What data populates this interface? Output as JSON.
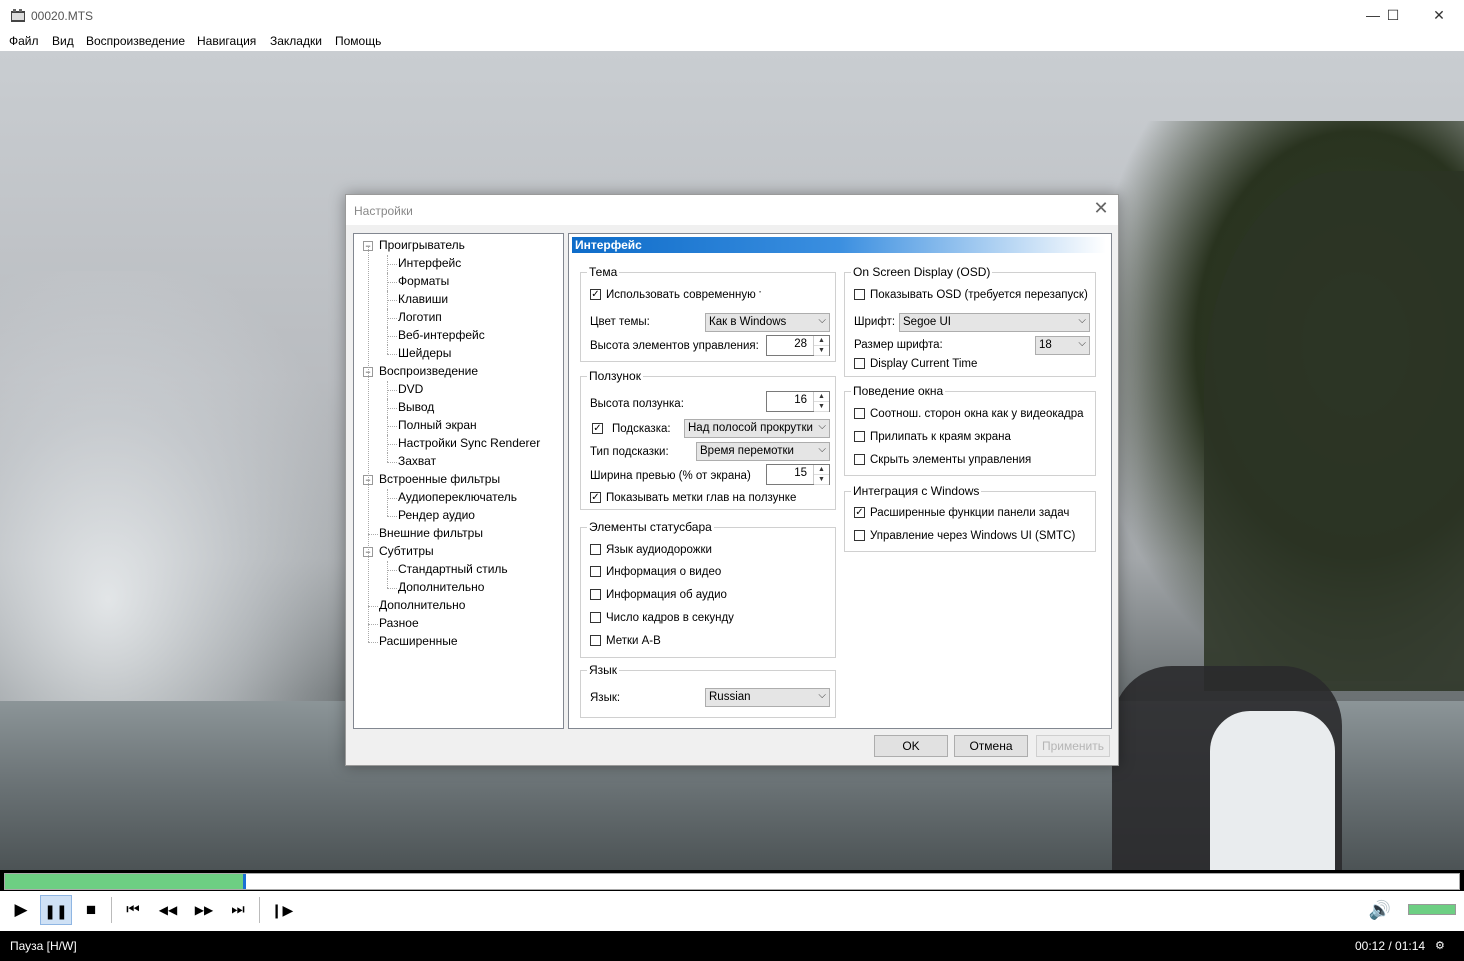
{
  "window": {
    "title": "00020.MTS",
    "minimize": "—",
    "maximize": "☐",
    "close": "✕"
  },
  "menu": [
    "Файл",
    "Вид",
    "Воспроизведение",
    "Навигация",
    "Закладки",
    "Помощь"
  ],
  "playback": {
    "progress_fraction": 0.164,
    "volume_fraction": 1.0
  },
  "status": {
    "state": "Пауза [H/W]",
    "time": "00:12 / 01:14"
  },
  "dialog": {
    "title": "Настройки",
    "close": "✕",
    "tree": [
      {
        "label": "Проигрыватель",
        "level": 0,
        "toggle": "−"
      },
      {
        "label": "Интерфейс",
        "level": 1
      },
      {
        "label": "Форматы",
        "level": 1
      },
      {
        "label": "Клавиши",
        "level": 1
      },
      {
        "label": "Логотип",
        "level": 1
      },
      {
        "label": "Веб-интерфейс",
        "level": 1
      },
      {
        "label": "Шейдеры",
        "level": 1
      },
      {
        "label": "Воспроизведение",
        "level": 0,
        "toggle": "−"
      },
      {
        "label": "DVD",
        "level": 1
      },
      {
        "label": "Вывод",
        "level": 1
      },
      {
        "label": "Полный экран",
        "level": 1
      },
      {
        "label": "Настройки Sync Renderer",
        "level": 1
      },
      {
        "label": "Захват",
        "level": 1
      },
      {
        "label": "Встроенные фильтры",
        "level": 0,
        "toggle": "−"
      },
      {
        "label": "Аудиопереключатель",
        "level": 1
      },
      {
        "label": "Рендер аудио",
        "level": 1
      },
      {
        "label": "Внешние фильтры",
        "level": 0
      },
      {
        "label": "Субтитры",
        "level": 0,
        "toggle": "−"
      },
      {
        "label": "Стандартный стиль",
        "level": 1
      },
      {
        "label": "Дополнительно",
        "level": 1
      },
      {
        "label": "Дополнительно",
        "level": 0
      },
      {
        "label": "Разное",
        "level": 0
      },
      {
        "label": "Расширенные",
        "level": 0
      }
    ],
    "page_title": "Интерфейс",
    "theme": {
      "label": "Тема",
      "use_modern": {
        "label": "Использовать современную те",
        "checked": true
      },
      "color_label": "Цвет темы:",
      "color_value": "Как в Windows",
      "height_label": "Высота элементов управления:",
      "height_value": "28"
    },
    "slider": {
      "label": "Ползунок",
      "height_label": "Высота ползунка:",
      "height_value": "16",
      "tooltip_label": "Подсказка:",
      "tooltip_checked": true,
      "tooltip_value": "Над полосой прокрутки",
      "tooltip_type_label": "Тип подсказки:",
      "tooltip_type_value": "Время перемотки",
      "preview_label": "Ширина превью (% от экрана)",
      "preview_value": "15",
      "chapters": {
        "label": "Показывать метки глав на ползунке",
        "checked": true
      }
    },
    "statusbar": {
      "label": "Элементы статусбара",
      "items": [
        {
          "label": "Язык аудиодорожки",
          "checked": false
        },
        {
          "label": "Информация о видео",
          "checked": false
        },
        {
          "label": "Информация об аудио",
          "checked": false
        },
        {
          "label": "Число кадров в секунду",
          "checked": false
        },
        {
          "label": "Метки A-B",
          "checked": false
        }
      ]
    },
    "language": {
      "label": "Язык",
      "field_label": "Язык:",
      "value": "Russian"
    },
    "osd": {
      "label": "On Screen Display (OSD)",
      "show": {
        "label": "Показывать OSD (требуется перезапуск)",
        "checked": false
      },
      "font_label": "Шрифт:",
      "font_value": "Segoe UI",
      "size_label": "Размер шрифта:",
      "size_value": "18",
      "current_time": {
        "label": "Display Current Time",
        "checked": false
      }
    },
    "window_behavior": {
      "label": "Поведение окна",
      "items": [
        {
          "label": "Соотнош. сторон окна как у видеокадра",
          "checked": false
        },
        {
          "label": "Прилипать к краям экрана",
          "checked": false
        },
        {
          "label": "Скрыть элементы управления",
          "checked": false
        }
      ]
    },
    "windows_integration": {
      "label": "Интеграция с Windows",
      "items": [
        {
          "label": "Расширенные функции панели задач",
          "checked": true
        },
        {
          "label": "Управление через Windows UI (SMTC)",
          "checked": false
        }
      ]
    },
    "buttons": {
      "ok": "OK",
      "cancel": "Отмена",
      "apply": "Применить"
    }
  },
  "icons": {
    "check": "✓",
    "dropdown": "⌵",
    "spin_up": "▲",
    "spin_down": "▼",
    "play": "▶",
    "pause": "❚❚",
    "stop": "■",
    "prev": "⏮",
    "rewind": "◀◀",
    "forward": "▶▶",
    "next": "⏭",
    "frame_step": "❙▶",
    "volume": "🔊"
  },
  "colors": {
    "accent": "#0e6cc9",
    "progress": "#6dcf83",
    "statusbar": "#000000"
  }
}
